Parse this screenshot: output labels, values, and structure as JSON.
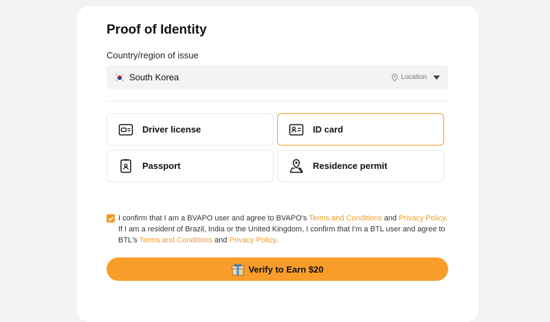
{
  "page": {
    "title": "Proof of Identity"
  },
  "country": {
    "label": "Country/region of issue",
    "selected": "South Korea",
    "location_label": "Location"
  },
  "documents": [
    {
      "label": "Driver license",
      "icon": "driver-license-icon",
      "selected": false
    },
    {
      "label": "ID card",
      "icon": "id-card-icon",
      "selected": true
    },
    {
      "label": "Passport",
      "icon": "passport-icon",
      "selected": false
    },
    {
      "label": "Residence permit",
      "icon": "residence-permit-icon",
      "selected": false
    }
  ],
  "consent": {
    "checked": true,
    "part1": "I confirm that I am a BVAPO user and agree to BVAPO's ",
    "link_terms_1": "Terms and Conditions",
    "and_1": " and ",
    "link_privacy_1": "Privacy Policy",
    "part2": ". If I am a resident of Brazil, India or the United Kingdom, I confirm that I'm a BTL user and agree to BTL's ",
    "link_terms_2": "Terms and Conditions",
    "and_2": " and ",
    "link_privacy_2": "Privacy Policy",
    "end": "."
  },
  "verify_button": {
    "label": "Verify to Earn $20",
    "icon": "gift-icon"
  },
  "colors": {
    "accent": "#f59a23",
    "button": "#f99d2a",
    "field_bg": "#f2f3f5"
  }
}
